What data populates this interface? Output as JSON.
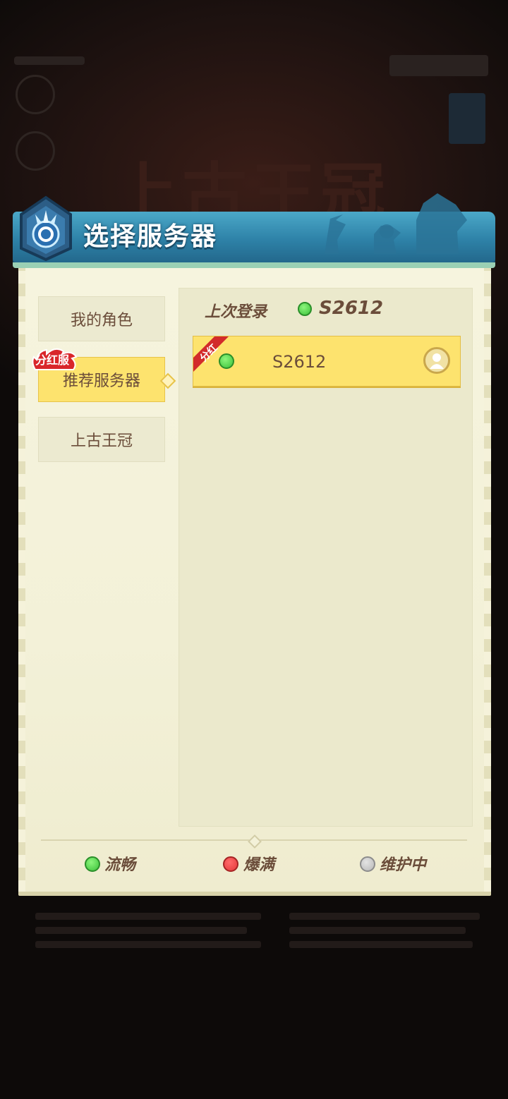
{
  "header": {
    "title": "选择服务器"
  },
  "background": {
    "logo_text": "上古王冠"
  },
  "tabs": [
    {
      "label": "我的角色",
      "active": false
    },
    {
      "label": "推荐服务器",
      "active": true,
      "badge": "分红服"
    },
    {
      "label": "上古王冠",
      "active": false
    }
  ],
  "last_login": {
    "label": "上次登录",
    "server": "S2612",
    "status": "green"
  },
  "servers": [
    {
      "name": "S2612",
      "status": "green",
      "tag": "分红"
    }
  ],
  "legend": [
    {
      "label": "流畅",
      "color": "#3cc23a"
    },
    {
      "label": "爆满",
      "color": "#e43a3a"
    },
    {
      "label": "维护中",
      "color": "#b8b8b8"
    }
  ],
  "colors": {
    "header_blue": "#2e82a8",
    "parchment": "#f3f1d8",
    "active_yellow": "#fde36e",
    "text_brown": "#6b4d3a"
  }
}
